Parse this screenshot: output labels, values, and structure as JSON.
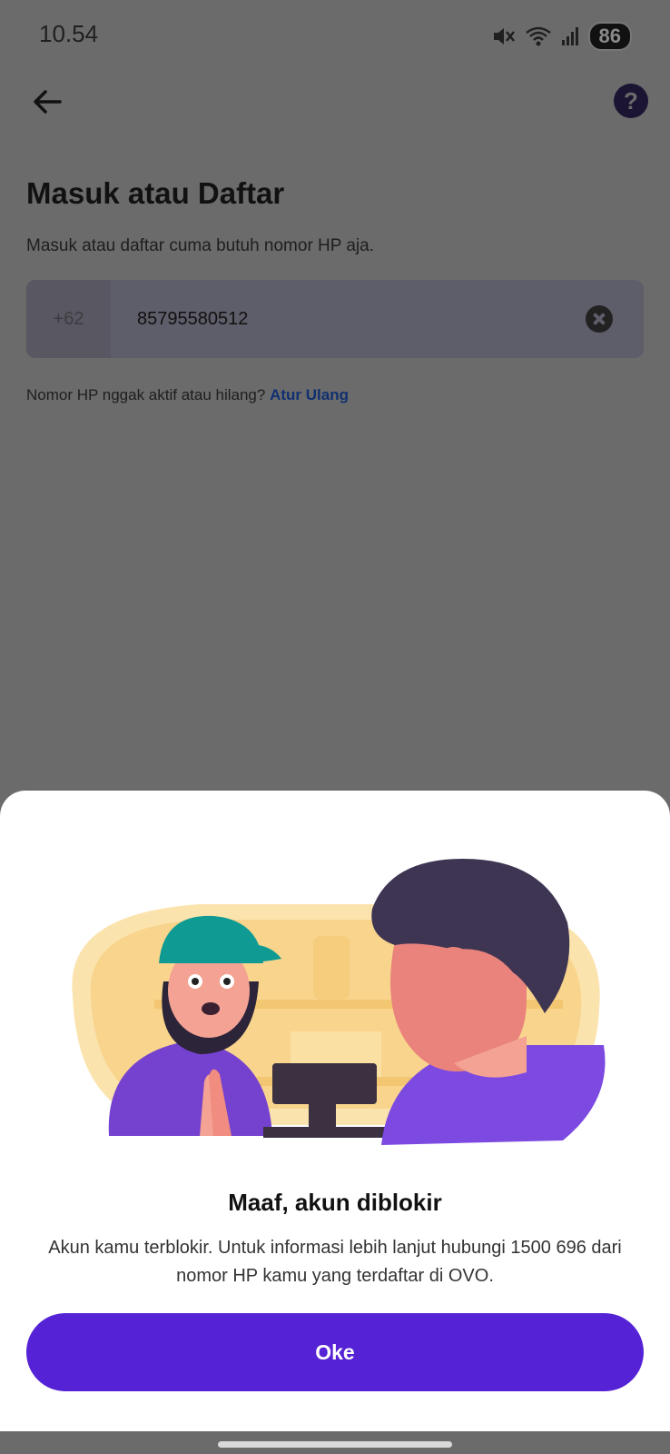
{
  "status_bar": {
    "time": "10.54",
    "battery": "86"
  },
  "header": {
    "help_label": "?"
  },
  "login": {
    "title": "Masuk atau Daftar",
    "subtitle": "Masuk atau daftar cuma butuh nomor HP aja.",
    "country_code": "+62",
    "phone_value": "85795580512",
    "reset_prompt": "Nomor HP nggak aktif atau hilang?",
    "reset_link": "Atur Ulang"
  },
  "dialog": {
    "title": "Maaf, akun diblokir",
    "message": "Akun kamu terblokir. Untuk informasi lebih lanjut hubungi 1500 696 dari nomor HP kamu yang terdaftar di OVO.",
    "ok_label": "Oke"
  },
  "colors": {
    "accent": "#5622d6",
    "overlay": "#6b6b6b",
    "link": "#103070"
  },
  "icons": [
    "back-arrow-icon",
    "help-icon",
    "clear-icon",
    "mute-icon",
    "wifi-icon",
    "signal-icon"
  ]
}
